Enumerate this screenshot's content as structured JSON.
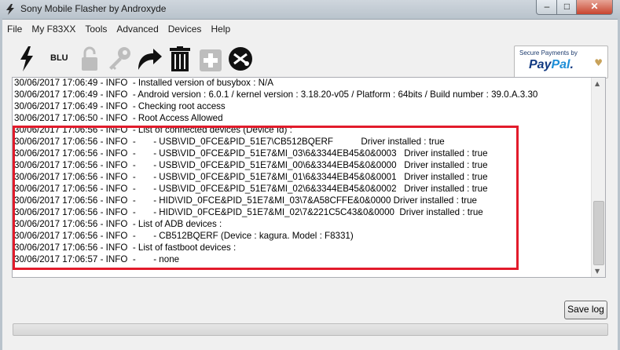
{
  "window": {
    "title": "Sony Mobile Flasher by Androxyde",
    "minimize_glyph": "–",
    "maximize_glyph": "□",
    "close_glyph": "✕"
  },
  "menu": [
    {
      "label": "File"
    },
    {
      "label": "My F83XX"
    },
    {
      "label": "Tools"
    },
    {
      "label": "Advanced"
    },
    {
      "label": "Devices"
    },
    {
      "label": "Help"
    }
  ],
  "toolbar": {
    "icons": [
      "flash-icon",
      "blu-icon",
      "lock-icon",
      "key-icon",
      "redo-arrow-icon",
      "trash-icon",
      "plus-icon",
      "xperia-firmware-icon"
    ],
    "blu_label": "BLU",
    "paypal": {
      "small_text": "Secure Payments by",
      "logo_pay": "Pay",
      "logo_pal": "Pal",
      "logo_dot": "."
    }
  },
  "log": {
    "lines": [
      "30/06/2017 17:06:49 - INFO  - Installed version of busybox : N/A",
      "30/06/2017 17:06:49 - INFO  - Android version : 6.0.1 / kernel version : 3.18.20-v05 / Platform : 64bits / Build number : 39.0.A.3.30",
      "30/06/2017 17:06:49 - INFO  - Checking root access",
      "30/06/2017 17:06:50 - INFO  - Root Access Allowed",
      "30/06/2017 17:06:56 - INFO  - List of connected devices (Device Id) :",
      "30/06/2017 17:06:56 - INFO  -       - USB\\VID_0FCE&PID_51E7\\CB512BQERF           Driver installed : true",
      "30/06/2017 17:06:56 - INFO  -       - USB\\VID_0FCE&PID_51E7&MI_03\\6&3344EB45&0&0003   Driver installed : true",
      "30/06/2017 17:06:56 - INFO  -       - USB\\VID_0FCE&PID_51E7&MI_00\\6&3344EB45&0&0000   Driver installed : true",
      "30/06/2017 17:06:56 - INFO  -       - USB\\VID_0FCE&PID_51E7&MI_01\\6&3344EB45&0&0001   Driver installed : true",
      "30/06/2017 17:06:56 - INFO  -       - USB\\VID_0FCE&PID_51E7&MI_02\\6&3344EB45&0&0002   Driver installed : true",
      "30/06/2017 17:06:56 - INFO  -       - HID\\VID_0FCE&PID_51E7&MI_03\\7&A58CFFE&0&0000 Driver installed : true",
      "30/06/2017 17:06:56 - INFO  -       - HID\\VID_0FCE&PID_51E7&MI_02\\7&221C5C43&0&0000  Driver installed : true",
      "30/06/2017 17:06:56 - INFO  - List of ADB devices :",
      "30/06/2017 17:06:56 - INFO  -       - CB512BQERF (Device : kagura. Model : F8331)",
      "30/06/2017 17:06:56 - INFO  - List of fastboot devices :",
      "30/06/2017 17:06:57 - INFO  -       - none"
    ],
    "highlight_color": "#e21b2b"
  },
  "buttons": {
    "save_log": "Save log"
  },
  "progress": {
    "fraction": 0
  },
  "colors": {
    "close_button": "#c8452f",
    "progress_fill": "#06b025",
    "paypal_dark": "#123a82",
    "paypal_light": "#1d8ed7"
  }
}
